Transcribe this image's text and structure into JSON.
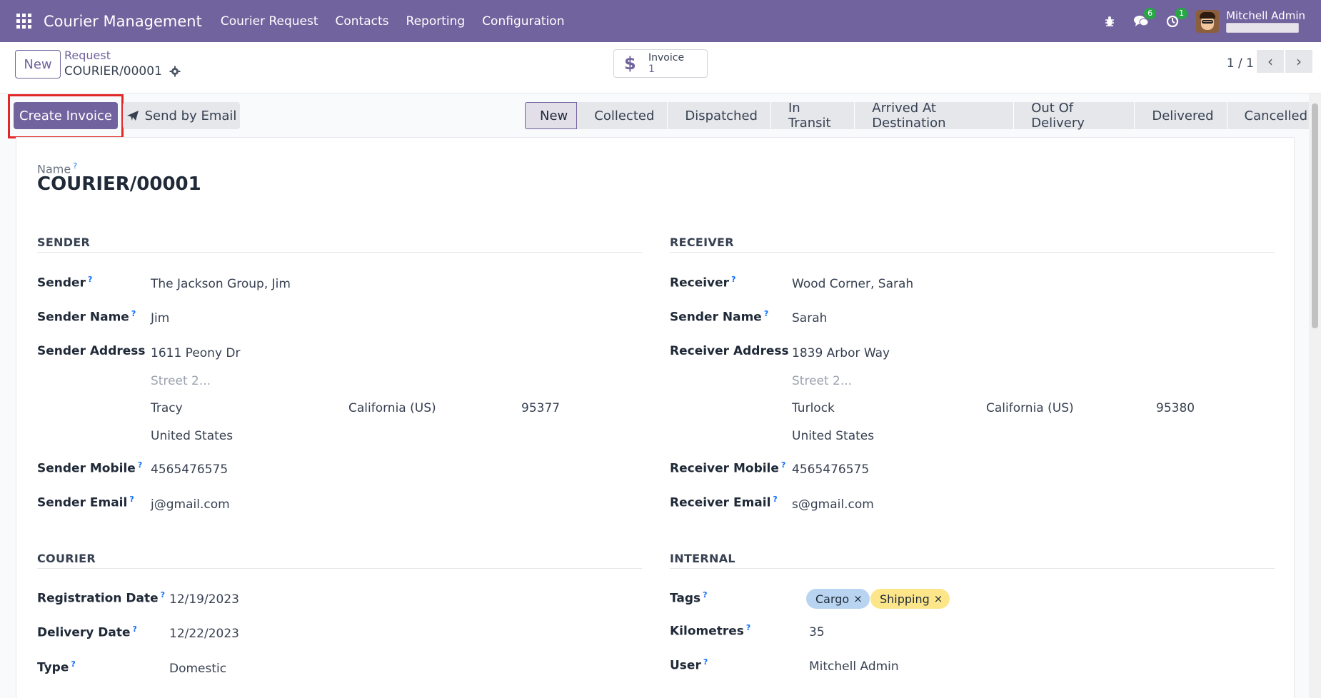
{
  "navbar": {
    "app_title": "Courier Management",
    "menu": [
      "Courier Request",
      "Contacts",
      "Reporting",
      "Configuration"
    ],
    "chat_count": "6",
    "activity_count": "1",
    "user_name": "Mitchell Admin"
  },
  "control": {
    "new_label": "New",
    "breadcrumb_parent": "Request",
    "breadcrumb_current": "COURIER/00001",
    "smart_label": "Invoice",
    "smart_value": "1",
    "pager": "1 / 1"
  },
  "actions": {
    "create_invoice": "Create Invoice",
    "send_email": "Send by Email"
  },
  "status": {
    "stages": [
      "New",
      "Collected",
      "Dispatched",
      "In Transit",
      "Arrived At Destination",
      "Out Of Delivery",
      "Delivered",
      "Cancelled"
    ],
    "current": "New"
  },
  "form": {
    "name_label": "Name",
    "name_value": "COURIER/00001",
    "sender_section": "SENDER",
    "receiver_section": "RECEIVER",
    "courier_section": "COURIER",
    "internal_section": "INTERNAL",
    "sender": {
      "sender_label": "Sender",
      "sender_value": "The Jackson Group, Jim",
      "name_label": "Sender Name",
      "name_value": "Jim",
      "address_label": "Sender Address",
      "street": "1611 Peony Dr",
      "street2_placeholder": "Street 2...",
      "city": "Tracy",
      "state": "California (US)",
      "zip": "95377",
      "country": "United States",
      "mobile_label": "Sender Mobile",
      "mobile_value": "4565476575",
      "email_label": "Sender Email",
      "email_value": "j@gmail.com"
    },
    "receiver": {
      "receiver_label": "Receiver",
      "receiver_value": "Wood Corner, Sarah",
      "name_label": "Sender Name",
      "name_value": "Sarah",
      "address_label": "Receiver Address",
      "street": "1839 Arbor Way",
      "street2_placeholder": "Street 2...",
      "city": "Turlock",
      "state": "California (US)",
      "zip": "95380",
      "country": "United States",
      "mobile_label": "Receiver Mobile",
      "mobile_value": "4565476575",
      "email_label": "Receiver Email",
      "email_value": "s@gmail.com"
    },
    "courier": {
      "reg_label": "Registration Date",
      "reg_value": "12/19/2023",
      "delivery_label": "Delivery Date",
      "delivery_value": "12/22/2023",
      "type_label": "Type",
      "type_value": "Domestic"
    },
    "internal": {
      "tags_label": "Tags",
      "tags": [
        "Cargo",
        "Shipping"
      ],
      "km_label": "Kilometres",
      "km_value": "35",
      "user_label": "User",
      "user_value": "Mitchell Admin"
    },
    "help_mark": "?"
  },
  "colors": {
    "brand": "#71639e",
    "tag_cargo": "#b8d4f0",
    "tag_shipping": "#fde68a",
    "highlight": "#e12828"
  }
}
